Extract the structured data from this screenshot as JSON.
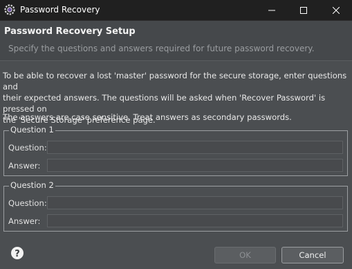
{
  "window": {
    "title": "Password Recovery"
  },
  "banner": {
    "title": "Password Recovery Setup",
    "subtitle": "Specify the questions and answers required for future password recovery."
  },
  "intro": {
    "line1": "To be able to recover a lost 'master' password for the secure storage, enter questions and",
    "line2": "their expected answers. The questions will be asked when 'Recover Password' is pressed on",
    "line3": "the 'Secure Storage' preference page."
  },
  "note": "The answers are case sensitive. Treat answers as secondary passwords.",
  "groups": [
    {
      "legend": "Question 1",
      "question_label": "Question:",
      "question_value": "",
      "answer_label": "Answer:",
      "answer_value": ""
    },
    {
      "legend": "Question 2",
      "question_label": "Question:",
      "question_value": "",
      "answer_label": "Answer:",
      "answer_value": ""
    }
  ],
  "buttons": {
    "ok": "OK",
    "cancel": "Cancel"
  },
  "icons": {
    "app": "eclipse-gear-icon",
    "help": "help-icon",
    "minimize": "minimize-icon",
    "maximize": "maximize-icon",
    "close": "close-icon"
  }
}
